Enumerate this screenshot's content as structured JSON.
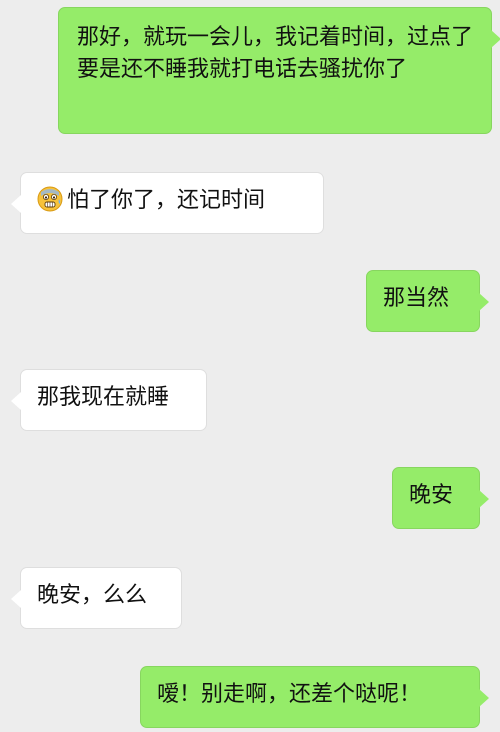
{
  "conversation": {
    "messages": [
      {
        "sender": "me",
        "text": "那好，就玩一会儿，我记着时间，过点了要是还不睡我就打电话去骚扰你了"
      },
      {
        "sender": "other",
        "emoji": "scared-face-icon",
        "text": "怕了你了，还记时间"
      },
      {
        "sender": "me",
        "text": "那当然"
      },
      {
        "sender": "other",
        "text": "那我现在就睡"
      },
      {
        "sender": "me",
        "text": "晚安"
      },
      {
        "sender": "other",
        "text": "晚安，么么"
      },
      {
        "sender": "me",
        "text": "嗳！别走啊，还差个哒呢！"
      }
    ]
  },
  "colors": {
    "background": "#ededed",
    "sent_bubble": "#95ec69",
    "received_bubble": "#ffffff"
  }
}
